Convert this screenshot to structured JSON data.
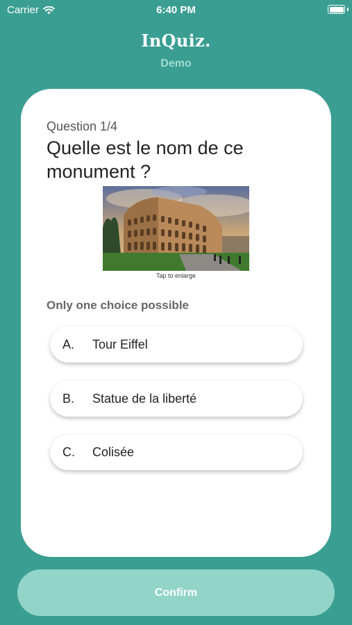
{
  "status_bar": {
    "carrier": "Carrier",
    "time": "6:40 PM"
  },
  "header": {
    "brand": "InQuiz.",
    "subtitle": "Demo"
  },
  "question": {
    "counter": "Question 1/4",
    "text": "Quelle est le nom de ce monument ?",
    "image_caption": "Tap to enlarge",
    "hint": "Only one choice possible"
  },
  "choices": [
    {
      "letter": "A.",
      "label": "Tour Eiffel"
    },
    {
      "letter": "B.",
      "label": "Statue de la liberté"
    },
    {
      "letter": "C.",
      "label": "Colisée"
    }
  ],
  "confirm": {
    "label": "Confirm"
  },
  "colors": {
    "background": "#3a9e92",
    "confirm_button": "#93d4c8",
    "subtitle": "#9fdbd2"
  }
}
